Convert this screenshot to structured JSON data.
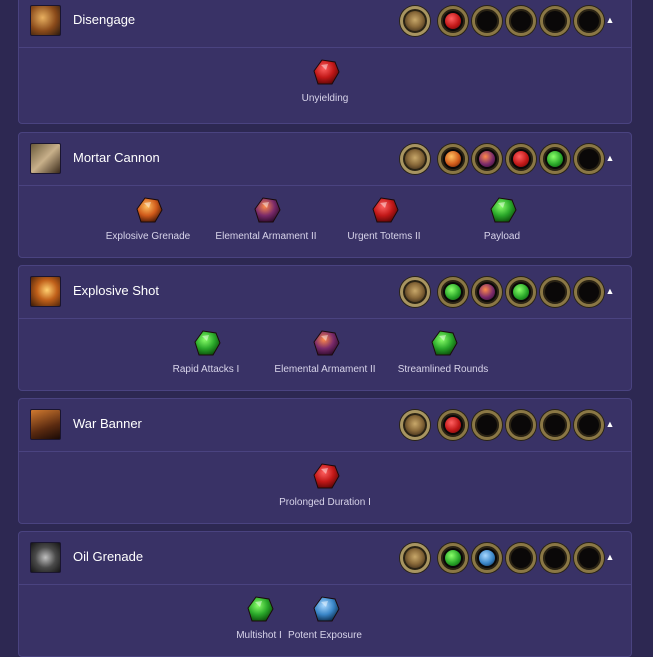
{
  "colors": {
    "page_bg": "#2d2852",
    "card_bg": "#393266",
    "card_border": "#4a4380",
    "text": "#ffffff",
    "label": "#d8d4ea",
    "socket_rim": "#8a7745",
    "gem_red": "#c21818",
    "gem_green": "#2aa82a",
    "gem_blue": "#3a86c8",
    "gem_purple": "#7a2a6a",
    "gem_orange": "#d05a1a"
  },
  "skills": [
    {
      "name": "Disengage",
      "icon": "disengage-skill-icon",
      "sockets": [
        "main",
        "red",
        "empty",
        "empty",
        "empty",
        "empty"
      ],
      "supports": [
        {
          "label": "Unyielding",
          "gem": "red"
        }
      ]
    },
    {
      "name": "Mortar Cannon",
      "icon": "mortar-cannon-skill-icon",
      "sockets": [
        "main",
        "orange",
        "purple",
        "red",
        "green",
        "empty"
      ],
      "supports": [
        {
          "label": "Explosive Grenade",
          "gem": "orange"
        },
        {
          "label": "Elemental Armament II",
          "gem": "purple"
        },
        {
          "label": "Urgent Totems II",
          "gem": "red"
        },
        {
          "label": "Payload",
          "gem": "green"
        }
      ]
    },
    {
      "name": "Explosive Shot",
      "icon": "explosive-shot-skill-icon",
      "sockets": [
        "main",
        "green",
        "purple",
        "green",
        "empty",
        "empty"
      ],
      "supports": [
        {
          "label": "Rapid Attacks I",
          "gem": "green"
        },
        {
          "label": "Elemental Armament II",
          "gem": "purple"
        },
        {
          "label": "Streamlined Rounds",
          "gem": "green"
        }
      ]
    },
    {
      "name": "War Banner",
      "icon": "war-banner-skill-icon",
      "sockets": [
        "main",
        "red",
        "empty",
        "empty",
        "empty",
        "empty"
      ],
      "supports": [
        {
          "label": "Prolonged Duration I",
          "gem": "red"
        }
      ]
    },
    {
      "name": "Oil Grenade",
      "icon": "oil-grenade-skill-icon",
      "sockets": [
        "main",
        "green",
        "blue",
        "empty",
        "empty",
        "empty"
      ],
      "supports": [
        {
          "label": "Multishot I",
          "gem": "green"
        },
        {
          "label": "Potent Exposure",
          "gem": "blue"
        }
      ]
    }
  ]
}
